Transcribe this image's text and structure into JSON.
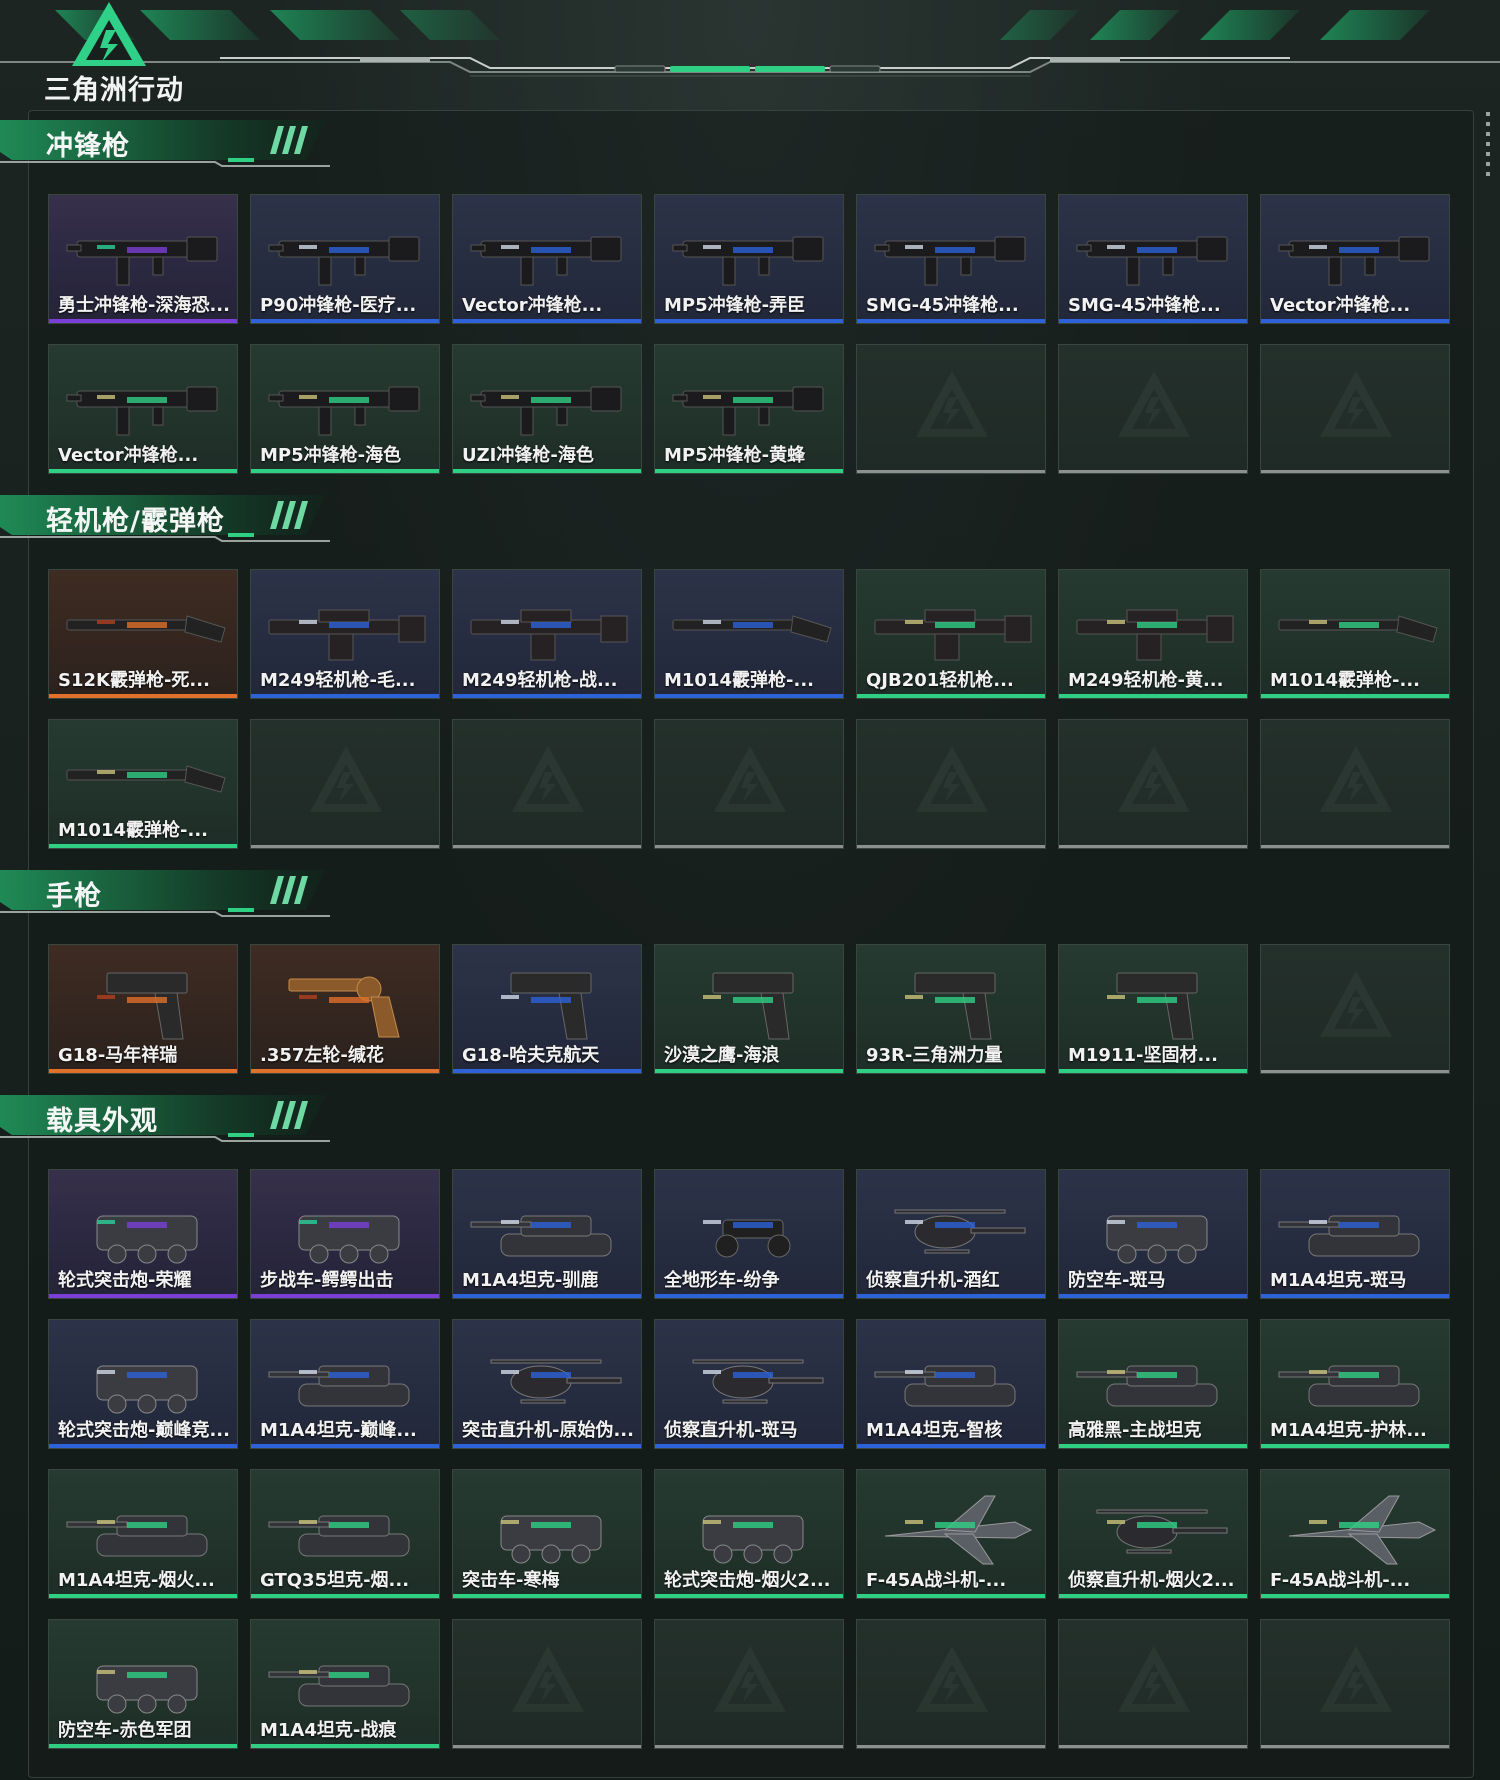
{
  "app": {
    "logo_text": "三角洲行动"
  },
  "colors": {
    "accent": "#2fcf84",
    "purple": "#7b3fd8",
    "blue": "#2d62d8",
    "green": "#2fcf84",
    "orange": "#e0702a",
    "empty": "#8b918e"
  },
  "sections": [
    {
      "title": "冲锋枪",
      "rows": [
        [
          {
            "label": "勇士冲锋枪-深海恐...",
            "rarity": "purple",
            "icon": "smg-icon"
          },
          {
            "label": "P90冲锋枪-医疗...",
            "rarity": "blue",
            "icon": "smg-icon"
          },
          {
            "label": "Vector冲锋枪...",
            "rarity": "blue",
            "icon": "smg-icon"
          },
          {
            "label": "MP5冲锋枪-弄臣",
            "rarity": "blue",
            "icon": "smg-icon"
          },
          {
            "label": "SMG-45冲锋枪...",
            "rarity": "blue",
            "icon": "smg-icon"
          },
          {
            "label": "SMG-45冲锋枪...",
            "rarity": "blue",
            "icon": "smg-icon"
          },
          {
            "label": "Vector冲锋枪...",
            "rarity": "blue",
            "icon": "smg-icon"
          }
        ],
        [
          {
            "label": "Vector冲锋枪...",
            "rarity": "green",
            "icon": "smg-icon"
          },
          {
            "label": "MP5冲锋枪-海色",
            "rarity": "green",
            "icon": "smg-icon"
          },
          {
            "label": "UZI冲锋枪-海色",
            "rarity": "green",
            "icon": "smg-icon"
          },
          {
            "label": "MP5冲锋枪-黄蜂",
            "rarity": "green",
            "icon": "smg-icon"
          },
          {
            "label": "",
            "rarity": "empty"
          },
          {
            "label": "",
            "rarity": "empty"
          },
          {
            "label": "",
            "rarity": "empty"
          }
        ]
      ]
    },
    {
      "title": "轻机枪/霰弹枪",
      "rows": [
        [
          {
            "label": "S12K霰弹枪-死...",
            "rarity": "orange",
            "icon": "shotgun-icon"
          },
          {
            "label": "M249轻机枪-毛...",
            "rarity": "blue",
            "icon": "lmg-icon"
          },
          {
            "label": "M249轻机枪-战...",
            "rarity": "blue",
            "icon": "lmg-icon"
          },
          {
            "label": "M1014霰弹枪-...",
            "rarity": "blue",
            "icon": "shotgun-icon"
          },
          {
            "label": "QJB201轻机枪...",
            "rarity": "green",
            "icon": "lmg-icon"
          },
          {
            "label": "M249轻机枪-黄...",
            "rarity": "green",
            "icon": "lmg-icon"
          },
          {
            "label": "M1014霰弹枪-...",
            "rarity": "green",
            "icon": "shotgun-icon"
          }
        ],
        [
          {
            "label": "M1014霰弹枪-...",
            "rarity": "green",
            "icon": "shotgun-icon"
          },
          {
            "label": "",
            "rarity": "empty"
          },
          {
            "label": "",
            "rarity": "empty"
          },
          {
            "label": "",
            "rarity": "empty"
          },
          {
            "label": "",
            "rarity": "empty"
          },
          {
            "label": "",
            "rarity": "empty"
          },
          {
            "label": "",
            "rarity": "empty"
          }
        ]
      ]
    },
    {
      "title": "手枪",
      "rows": [
        [
          {
            "label": "G18-马年祥瑞",
            "rarity": "orange",
            "icon": "pistol-icon"
          },
          {
            "label": ".357左轮-缄花",
            "rarity": "orange",
            "icon": "revolver-icon"
          },
          {
            "label": "G18-哈夫克航天",
            "rarity": "blue",
            "icon": "pistol-icon"
          },
          {
            "label": "沙漠之鹰-海浪",
            "rarity": "green",
            "icon": "pistol-icon"
          },
          {
            "label": "93R-三角洲力量",
            "rarity": "green",
            "icon": "pistol-icon"
          },
          {
            "label": "M1911-坚固材...",
            "rarity": "green",
            "icon": "pistol-icon"
          },
          {
            "label": "",
            "rarity": "empty"
          }
        ]
      ]
    },
    {
      "title": "载具外观",
      "rows": [
        [
          {
            "label": "轮式突击炮-荣耀",
            "rarity": "purple",
            "icon": "armored-car-icon"
          },
          {
            "label": "步战车-鳄鳄出击",
            "rarity": "purple",
            "icon": "armored-car-icon"
          },
          {
            "label": "M1A4坦克-驯鹿",
            "rarity": "blue",
            "icon": "tank-icon"
          },
          {
            "label": "全地形车-纷争",
            "rarity": "blue",
            "icon": "atv-icon"
          },
          {
            "label": "侦察直升机-酒红",
            "rarity": "blue",
            "icon": "helicopter-icon"
          },
          {
            "label": "防空车-斑马",
            "rarity": "blue",
            "icon": "armored-car-icon"
          },
          {
            "label": "M1A4坦克-斑马",
            "rarity": "blue",
            "icon": "tank-icon"
          }
        ],
        [
          {
            "label": "轮式突击炮-巅峰竞...",
            "rarity": "blue",
            "icon": "armored-car-icon"
          },
          {
            "label": "M1A4坦克-巅峰...",
            "rarity": "blue",
            "icon": "tank-icon"
          },
          {
            "label": "突击直升机-原始伪...",
            "rarity": "blue",
            "icon": "helicopter-icon"
          },
          {
            "label": "侦察直升机-斑马",
            "rarity": "blue",
            "icon": "helicopter-icon"
          },
          {
            "label": "M1A4坦克-智核",
            "rarity": "blue",
            "icon": "tank-icon"
          },
          {
            "label": "高雅黑-主战坦克",
            "rarity": "green",
            "icon": "tank-icon"
          },
          {
            "label": "M1A4坦克-护林...",
            "rarity": "green",
            "icon": "tank-icon"
          }
        ],
        [
          {
            "label": "M1A4坦克-烟火...",
            "rarity": "green",
            "icon": "tank-icon"
          },
          {
            "label": "GTQ35坦克-烟...",
            "rarity": "green",
            "icon": "tank-icon"
          },
          {
            "label": "突击车-寒梅",
            "rarity": "green",
            "icon": "armored-car-icon"
          },
          {
            "label": "轮式突击炮-烟火2...",
            "rarity": "green",
            "icon": "armored-car-icon"
          },
          {
            "label": "F-45A战斗机-...",
            "rarity": "green",
            "icon": "jet-icon"
          },
          {
            "label": "侦察直升机-烟火2...",
            "rarity": "green",
            "icon": "helicopter-icon"
          },
          {
            "label": "F-45A战斗机-...",
            "rarity": "green",
            "icon": "jet-icon"
          }
        ],
        [
          {
            "label": "防空车-赤色军团",
            "rarity": "green",
            "icon": "armored-car-icon"
          },
          {
            "label": "M1A4坦克-战痕",
            "rarity": "green",
            "icon": "tank-icon"
          },
          {
            "label": "",
            "rarity": "empty"
          },
          {
            "label": "",
            "rarity": "empty"
          },
          {
            "label": "",
            "rarity": "empty"
          },
          {
            "label": "",
            "rarity": "empty"
          },
          {
            "label": "",
            "rarity": "empty"
          }
        ]
      ]
    }
  ]
}
